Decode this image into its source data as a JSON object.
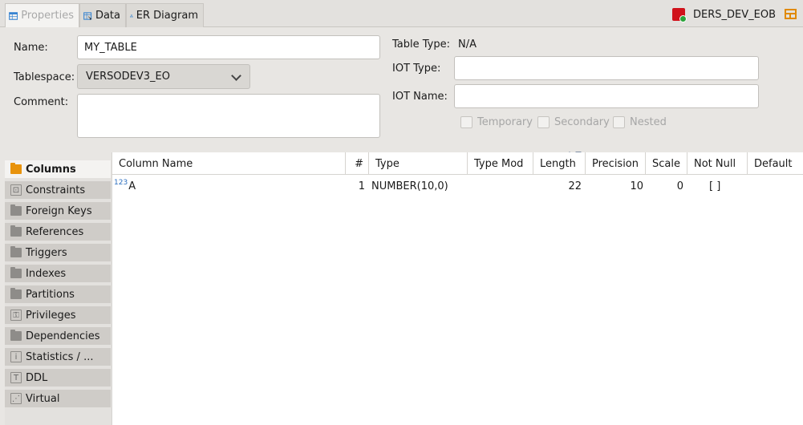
{
  "tabs": [
    {
      "label": "Properties"
    },
    {
      "label": "Data"
    },
    {
      "label": "ER Diagram"
    }
  ],
  "connection": {
    "label": "DERS_DEV_EOB"
  },
  "properties": {
    "name_label": "Name:",
    "name_value": "MY_TABLE",
    "tablespace_label": "Tablespace:",
    "tablespace_value": "VERSODEV3_EO",
    "comment_label": "Comment:",
    "comment_value": "",
    "table_type_label": "Table Type:",
    "table_type_value": "N/A",
    "iot_type_label": "IOT Type:",
    "iot_type_value": "",
    "iot_name_label": "IOT Name:",
    "iot_name_value": "",
    "checkboxes": [
      {
        "label": "Temporary",
        "checked": false
      },
      {
        "label": "Secondary",
        "checked": false
      },
      {
        "label": "Nested",
        "checked": false
      }
    ]
  },
  "sidebar": {
    "items": [
      {
        "label": "Columns",
        "active": true
      },
      {
        "label": "Constraints"
      },
      {
        "label": "Foreign Keys"
      },
      {
        "label": "References"
      },
      {
        "label": "Triggers"
      },
      {
        "label": "Indexes"
      },
      {
        "label": "Partitions"
      },
      {
        "label": "Privileges"
      },
      {
        "label": "Dependencies"
      },
      {
        "label": "Statistics / ..."
      },
      {
        "label": "DDL"
      },
      {
        "label": "Virtual"
      }
    ]
  },
  "grid": {
    "headers": [
      "Column Name",
      "#",
      "Type",
      "Type Mod",
      "Length",
      "Precision",
      "Scale",
      "Not Null",
      "Default"
    ],
    "rows": [
      {
        "type_badge": "123",
        "name": "A",
        "num": "1",
        "type": "NUMBER(10,0)",
        "type_mod": "",
        "length": "22",
        "precision": "10",
        "scale": "0",
        "not_null": "[ ]",
        "default": ""
      }
    ]
  },
  "colors": {
    "accent_orange": "#e8930c",
    "connection_red": "#d0121b",
    "number_badge_blue": "#2d6fbf"
  }
}
